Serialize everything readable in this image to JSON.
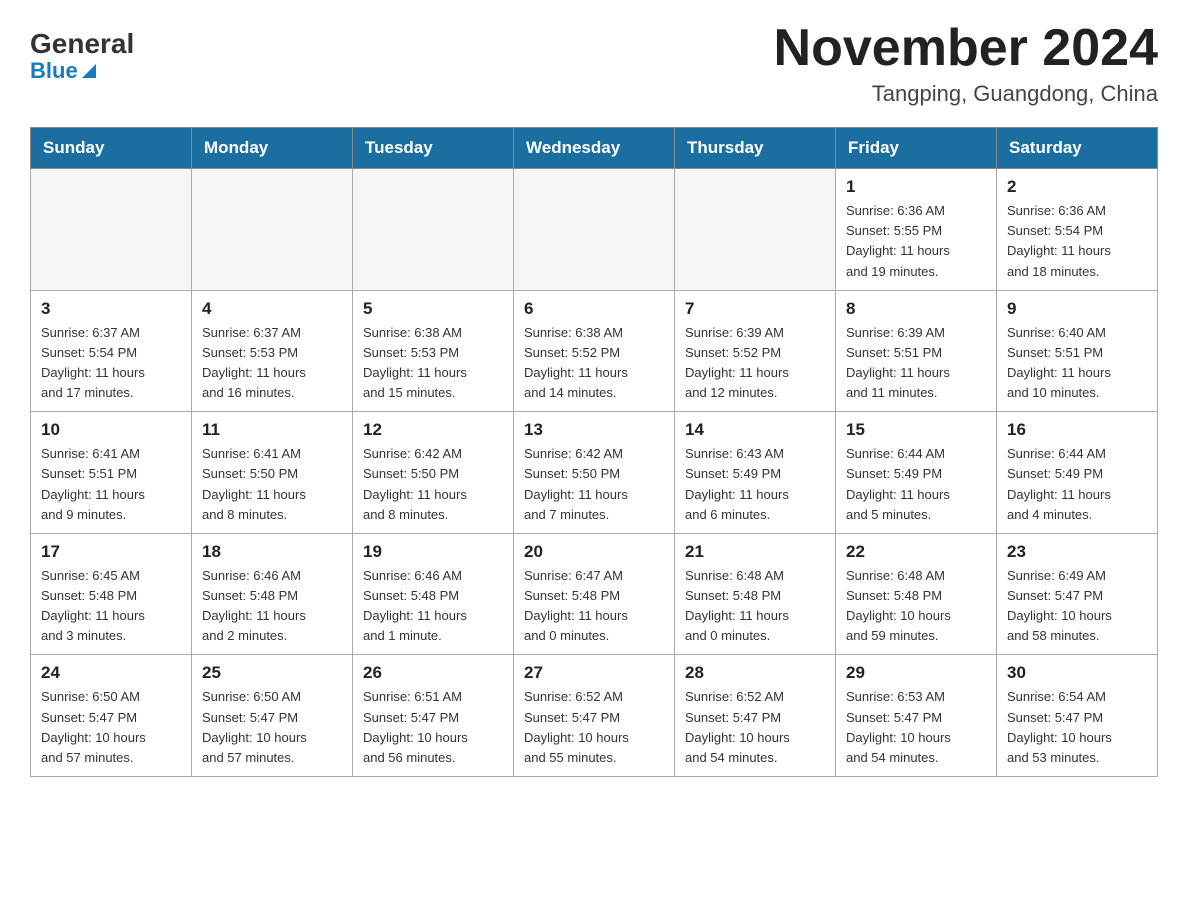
{
  "header": {
    "logo_general": "General",
    "logo_blue": "Blue",
    "month_year": "November 2024",
    "location": "Tangping, Guangdong, China"
  },
  "days_of_week": [
    "Sunday",
    "Monday",
    "Tuesday",
    "Wednesday",
    "Thursday",
    "Friday",
    "Saturday"
  ],
  "weeks": [
    [
      {
        "day": "",
        "info": ""
      },
      {
        "day": "",
        "info": ""
      },
      {
        "day": "",
        "info": ""
      },
      {
        "day": "",
        "info": ""
      },
      {
        "day": "",
        "info": ""
      },
      {
        "day": "1",
        "info": "Sunrise: 6:36 AM\nSunset: 5:55 PM\nDaylight: 11 hours\nand 19 minutes."
      },
      {
        "day": "2",
        "info": "Sunrise: 6:36 AM\nSunset: 5:54 PM\nDaylight: 11 hours\nand 18 minutes."
      }
    ],
    [
      {
        "day": "3",
        "info": "Sunrise: 6:37 AM\nSunset: 5:54 PM\nDaylight: 11 hours\nand 17 minutes."
      },
      {
        "day": "4",
        "info": "Sunrise: 6:37 AM\nSunset: 5:53 PM\nDaylight: 11 hours\nand 16 minutes."
      },
      {
        "day": "5",
        "info": "Sunrise: 6:38 AM\nSunset: 5:53 PM\nDaylight: 11 hours\nand 15 minutes."
      },
      {
        "day": "6",
        "info": "Sunrise: 6:38 AM\nSunset: 5:52 PM\nDaylight: 11 hours\nand 14 minutes."
      },
      {
        "day": "7",
        "info": "Sunrise: 6:39 AM\nSunset: 5:52 PM\nDaylight: 11 hours\nand 12 minutes."
      },
      {
        "day": "8",
        "info": "Sunrise: 6:39 AM\nSunset: 5:51 PM\nDaylight: 11 hours\nand 11 minutes."
      },
      {
        "day": "9",
        "info": "Sunrise: 6:40 AM\nSunset: 5:51 PM\nDaylight: 11 hours\nand 10 minutes."
      }
    ],
    [
      {
        "day": "10",
        "info": "Sunrise: 6:41 AM\nSunset: 5:51 PM\nDaylight: 11 hours\nand 9 minutes."
      },
      {
        "day": "11",
        "info": "Sunrise: 6:41 AM\nSunset: 5:50 PM\nDaylight: 11 hours\nand 8 minutes."
      },
      {
        "day": "12",
        "info": "Sunrise: 6:42 AM\nSunset: 5:50 PM\nDaylight: 11 hours\nand 8 minutes."
      },
      {
        "day": "13",
        "info": "Sunrise: 6:42 AM\nSunset: 5:50 PM\nDaylight: 11 hours\nand 7 minutes."
      },
      {
        "day": "14",
        "info": "Sunrise: 6:43 AM\nSunset: 5:49 PM\nDaylight: 11 hours\nand 6 minutes."
      },
      {
        "day": "15",
        "info": "Sunrise: 6:44 AM\nSunset: 5:49 PM\nDaylight: 11 hours\nand 5 minutes."
      },
      {
        "day": "16",
        "info": "Sunrise: 6:44 AM\nSunset: 5:49 PM\nDaylight: 11 hours\nand 4 minutes."
      }
    ],
    [
      {
        "day": "17",
        "info": "Sunrise: 6:45 AM\nSunset: 5:48 PM\nDaylight: 11 hours\nand 3 minutes."
      },
      {
        "day": "18",
        "info": "Sunrise: 6:46 AM\nSunset: 5:48 PM\nDaylight: 11 hours\nand 2 minutes."
      },
      {
        "day": "19",
        "info": "Sunrise: 6:46 AM\nSunset: 5:48 PM\nDaylight: 11 hours\nand 1 minute."
      },
      {
        "day": "20",
        "info": "Sunrise: 6:47 AM\nSunset: 5:48 PM\nDaylight: 11 hours\nand 0 minutes."
      },
      {
        "day": "21",
        "info": "Sunrise: 6:48 AM\nSunset: 5:48 PM\nDaylight: 11 hours\nand 0 minutes."
      },
      {
        "day": "22",
        "info": "Sunrise: 6:48 AM\nSunset: 5:48 PM\nDaylight: 10 hours\nand 59 minutes."
      },
      {
        "day": "23",
        "info": "Sunrise: 6:49 AM\nSunset: 5:47 PM\nDaylight: 10 hours\nand 58 minutes."
      }
    ],
    [
      {
        "day": "24",
        "info": "Sunrise: 6:50 AM\nSunset: 5:47 PM\nDaylight: 10 hours\nand 57 minutes."
      },
      {
        "day": "25",
        "info": "Sunrise: 6:50 AM\nSunset: 5:47 PM\nDaylight: 10 hours\nand 57 minutes."
      },
      {
        "day": "26",
        "info": "Sunrise: 6:51 AM\nSunset: 5:47 PM\nDaylight: 10 hours\nand 56 minutes."
      },
      {
        "day": "27",
        "info": "Sunrise: 6:52 AM\nSunset: 5:47 PM\nDaylight: 10 hours\nand 55 minutes."
      },
      {
        "day": "28",
        "info": "Sunrise: 6:52 AM\nSunset: 5:47 PM\nDaylight: 10 hours\nand 54 minutes."
      },
      {
        "day": "29",
        "info": "Sunrise: 6:53 AM\nSunset: 5:47 PM\nDaylight: 10 hours\nand 54 minutes."
      },
      {
        "day": "30",
        "info": "Sunrise: 6:54 AM\nSunset: 5:47 PM\nDaylight: 10 hours\nand 53 minutes."
      }
    ]
  ]
}
